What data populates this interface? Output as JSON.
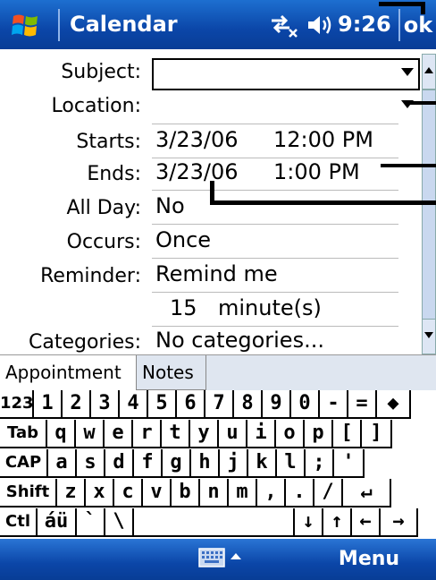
{
  "titlebar": {
    "app_title": "Calendar",
    "clock": "9:26",
    "ok_label": "ok",
    "icons": [
      "windows-flag-icon",
      "connectivity-icon",
      "volume-icon"
    ]
  },
  "form": {
    "subject": {
      "label": "Subject:",
      "value": ""
    },
    "location": {
      "label": "Location:",
      "value": ""
    },
    "starts": {
      "label": "Starts:",
      "date": "3/23/06",
      "time": "12:00 PM"
    },
    "ends": {
      "label": "Ends:",
      "date": "3/23/06",
      "time": "1:00 PM"
    },
    "all_day": {
      "label": "All Day:",
      "value": "No"
    },
    "occurs": {
      "label": "Occurs:",
      "value": "Once"
    },
    "reminder": {
      "label": "Reminder:",
      "value": "Remind me",
      "amount": "15",
      "unit": "minute(s)"
    },
    "categories": {
      "label": "Categories:",
      "value": "No categories..."
    }
  },
  "tabs": [
    {
      "label": "Appointment",
      "active": true
    },
    {
      "label": "Notes",
      "active": false
    }
  ],
  "keyboard": {
    "rows": [
      [
        "123",
        "1",
        "2",
        "3",
        "4",
        "5",
        "6",
        "7",
        "8",
        "9",
        "0",
        "-",
        "=",
        "◆"
      ],
      [
        "Tab",
        "q",
        "w",
        "e",
        "r",
        "t",
        "y",
        "u",
        "i",
        "o",
        "p",
        "[",
        "]"
      ],
      [
        "CAP",
        "a",
        "s",
        "d",
        "f",
        "g",
        "h",
        "j",
        "k",
        "l",
        ";",
        "'"
      ],
      [
        "Shift",
        "z",
        "x",
        "c",
        "v",
        "b",
        "n",
        "m",
        ",",
        ".",
        "/",
        "↵"
      ],
      [
        "Ctl",
        "áü",
        "`",
        "\\",
        "",
        "↓",
        "↑",
        "←",
        "→"
      ]
    ]
  },
  "bottombar": {
    "menu_label": "Menu"
  },
  "colors": {
    "titlebar": "#0b46a8",
    "tab_bg": "#dfe6f0"
  }
}
